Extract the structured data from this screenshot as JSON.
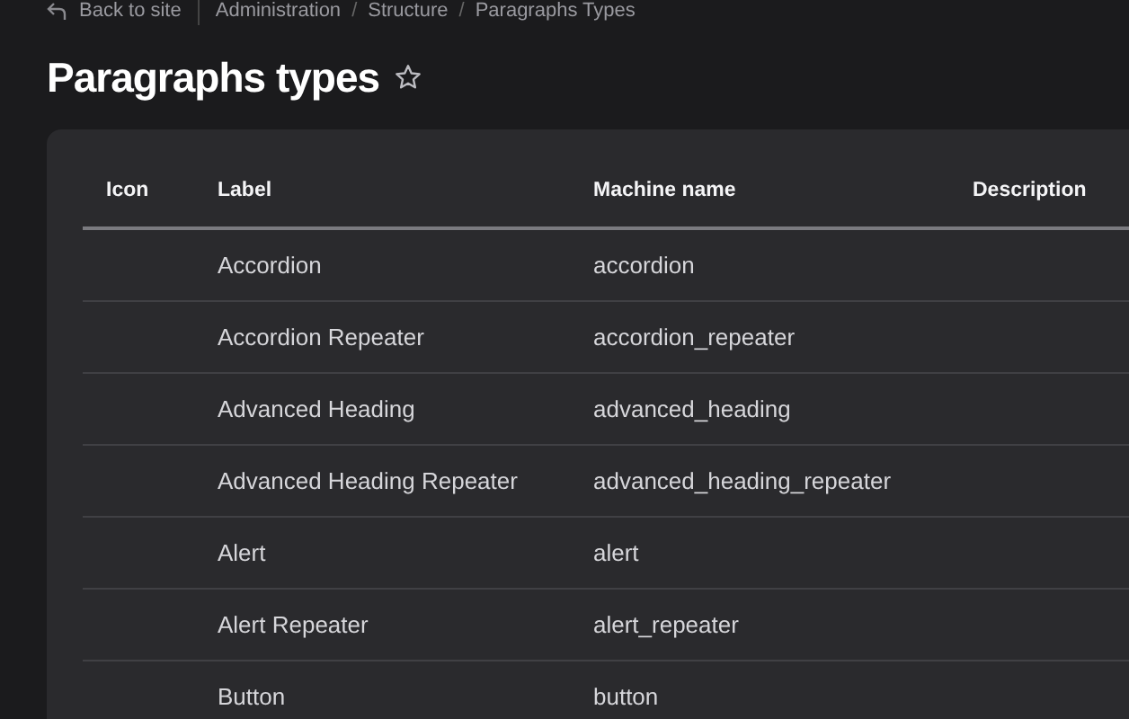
{
  "breadcrumb": {
    "back_link": "Back to site",
    "items": [
      "Administration",
      "Structure",
      "Paragraphs Types"
    ],
    "separator": "/"
  },
  "page_title": "Paragraphs types",
  "table": {
    "columns": [
      "Icon",
      "Label",
      "Machine name",
      "Description"
    ],
    "rows": [
      {
        "label": "Accordion",
        "machine_name": "accordion"
      },
      {
        "label": "Accordion Repeater",
        "machine_name": "accordion_repeater"
      },
      {
        "label": "Advanced Heading",
        "machine_name": "advanced_heading"
      },
      {
        "label": "Advanced Heading Repeater",
        "machine_name": "advanced_heading_repeater"
      },
      {
        "label": "Alert",
        "machine_name": "alert"
      },
      {
        "label": "Alert Repeater",
        "machine_name": "alert_repeater"
      },
      {
        "label": "Button",
        "machine_name": "button"
      }
    ]
  }
}
